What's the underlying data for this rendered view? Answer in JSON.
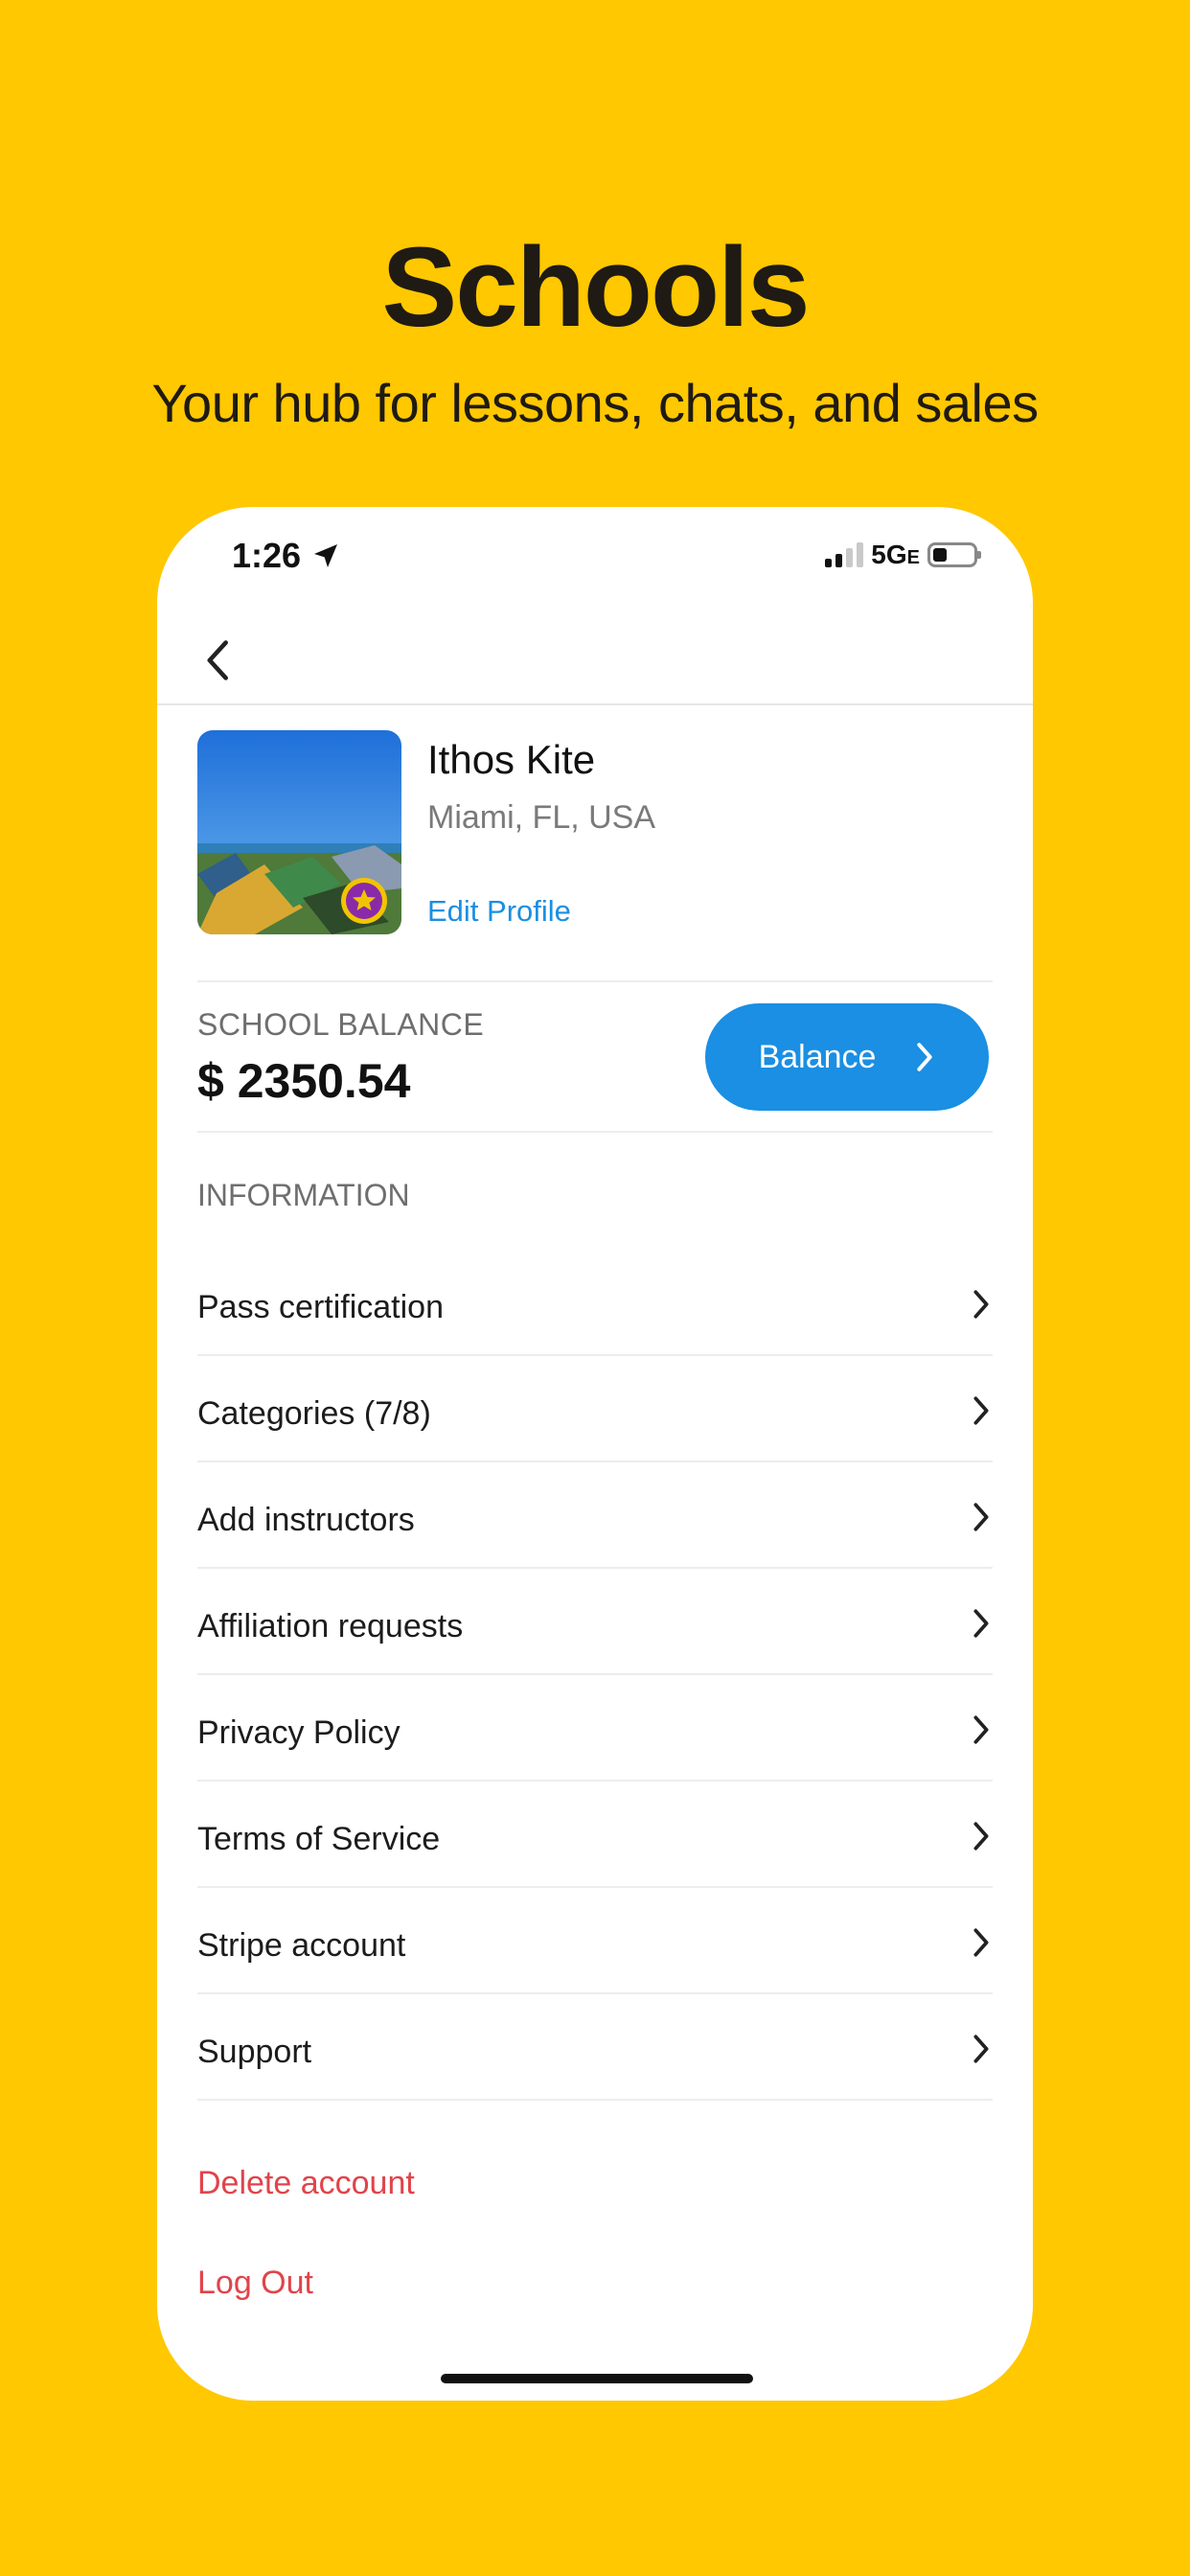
{
  "hero": {
    "title": "Schools",
    "subtitle": "Your hub for lessons, chats, and sales"
  },
  "status_bar": {
    "time": "1:26",
    "network": "5G",
    "network_suffix": "E"
  },
  "profile": {
    "name": "Ithos Kite",
    "location": "Miami, FL, USA",
    "edit_label": "Edit Profile"
  },
  "balance": {
    "label": "SCHOOL BALANCE",
    "amount": "$ 2350.54",
    "button_label": "Balance"
  },
  "information": {
    "section_label": "INFORMATION",
    "items": [
      {
        "label": "Pass certification"
      },
      {
        "label": "Categories (7/8)"
      },
      {
        "label": "Add instructors"
      },
      {
        "label": "Affiliation requests"
      },
      {
        "label": "Privacy Policy"
      },
      {
        "label": "Terms of Service"
      },
      {
        "label": "Stripe account"
      },
      {
        "label": "Support"
      }
    ]
  },
  "account_actions": {
    "delete_label": "Delete account",
    "logout_label": "Log Out"
  },
  "colors": {
    "background": "#FFC800",
    "accent": "#1A8FE3",
    "danger": "#E0444B"
  },
  "icons": [
    "location-arrow-icon",
    "signal-icon",
    "battery-icon",
    "back-chevron-icon",
    "chevron-right-icon",
    "badge-star-icon"
  ]
}
